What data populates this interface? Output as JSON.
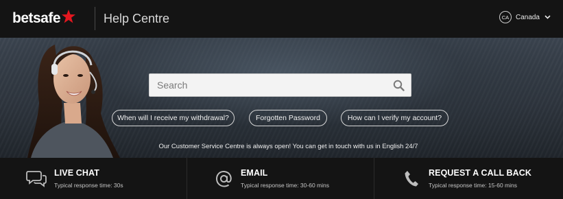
{
  "header": {
    "logo": "betsafe",
    "title": "Help Centre",
    "country_code": "CA",
    "country_name": "Canada"
  },
  "search": {
    "placeholder": "Search"
  },
  "quick_links": [
    "When will I receive my withdrawal?",
    "Forgotten Password",
    "How can I verify my account?"
  ],
  "open_note": "Our Customer Service Centre is always open! You can get in touch with us in English 24/7",
  "contacts": [
    {
      "title": "LIVE CHAT",
      "subtitle": "Typical response time: 30s",
      "icon": "chat-icon"
    },
    {
      "title": "EMAIL",
      "subtitle": "Typical response time: 30-60 mins",
      "icon": "at-icon"
    },
    {
      "title": "REQUEST A CALL BACK",
      "subtitle": "Typical response time: 15-60 mins",
      "icon": "phone-icon"
    }
  ],
  "colors": {
    "brand_red": "#e3171f",
    "header_bg": "#141414"
  }
}
